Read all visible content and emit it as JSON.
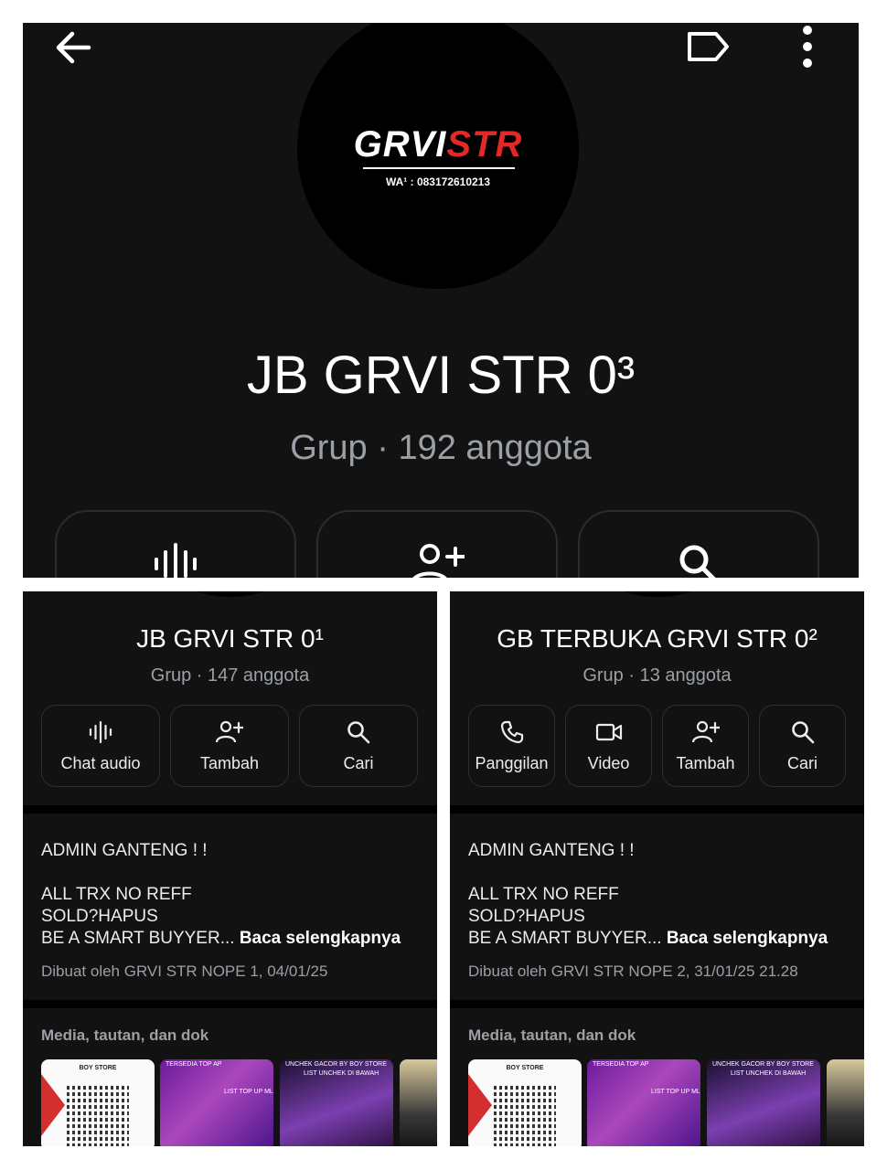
{
  "top": {
    "title": "JB GRVI STR 0³",
    "subtitle": "Grup · 192 anggota",
    "logo_main": "GRVI",
    "logo_str": "STR",
    "logo_sub": "WA¹ : 083172610213",
    "icons": [
      "back-arrow-icon",
      "label-icon",
      "more-vert-icon",
      "audio-wave-icon",
      "add-person-icon",
      "search-icon"
    ]
  },
  "left": {
    "title": "JB GRVI STR 0¹",
    "subtitle": "Grup · 147 anggota",
    "actions": [
      {
        "label": "Chat audio",
        "icon": "audio-wave-icon"
      },
      {
        "label": "Tambah",
        "icon": "add-person-icon"
      },
      {
        "label": "Cari",
        "icon": "search-icon"
      }
    ],
    "description": {
      "line1": "ADMIN GANTENG ! !",
      "line2": "ALL TRX NO REFF",
      "line3": "SOLD?HAPUS",
      "line4": "BE A SMART BUYYER...",
      "more": "Baca selengkapnya"
    },
    "created_by": "Dibuat oleh GRVI STR NOPE 1, 04/01/25",
    "media_heading": "Media, tautan, dan dok"
  },
  "right": {
    "title": "GB TERBUKA GRVI STR 0²",
    "subtitle": "Grup · 13 anggota",
    "actions": [
      {
        "label": "Panggilan",
        "icon": "phone-icon"
      },
      {
        "label": "Video",
        "icon": "video-icon"
      },
      {
        "label": "Tambah",
        "icon": "add-person-icon"
      },
      {
        "label": "Cari",
        "icon": "search-icon"
      }
    ],
    "description": {
      "line1": "ADMIN GANTENG ! !",
      "line2": "ALL TRX NO REFF",
      "line3": "SOLD?HAPUS",
      "line4": "BE A SMART BUYYER...",
      "more": "Baca selengkapnya"
    },
    "created_by": "Dibuat oleh GRVI STR NOPE 2, 31/01/25 21.28",
    "media_heading": "Media, tautan, dan dok"
  },
  "thumbs": {
    "t1_caption": "BOY STORE",
    "t2_caption": "TERSEDIA TOP AP",
    "t2_line2": "LIST TOP UP ML",
    "t3_caption": "UNCHEK GACOR BY BOY STORE",
    "t3_line2": "LIST UNCHEK DI BAWAH"
  },
  "colors": {
    "panel_bg": "#121212",
    "text_primary": "#e9edef",
    "text_secondary": "#9aa0a6",
    "logo_accent": "#e42828"
  }
}
